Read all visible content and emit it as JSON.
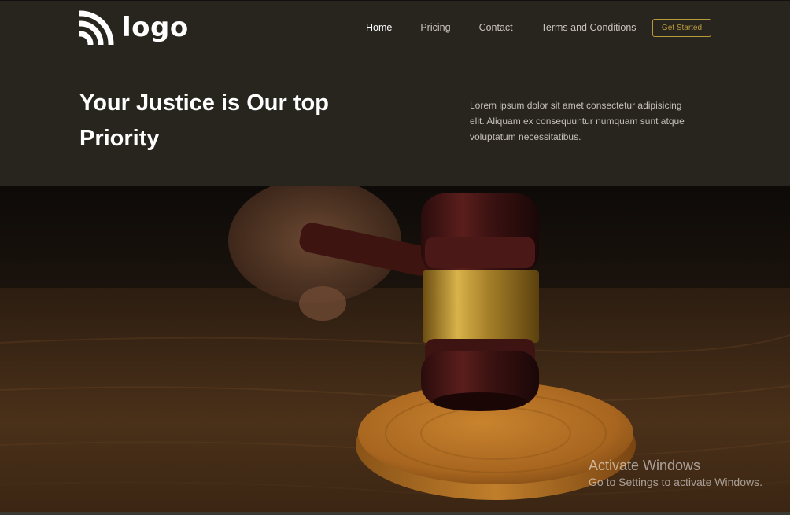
{
  "header": {
    "logo_text": "logo",
    "nav": [
      {
        "label": "Home",
        "active": true
      },
      {
        "label": "Pricing",
        "active": false
      },
      {
        "label": "Contact",
        "active": false
      },
      {
        "label": "Terms and Conditions",
        "active": false
      }
    ],
    "cta_label": "Get Started"
  },
  "hero": {
    "title": "Your Justice is Our top Priority",
    "description": "Lorem ipsum dolor sit amet consectetur adipisicing elit. Aliquam ex consequuntur numquam sunt atque voluptatum necessitatibus.",
    "image_subject": "gavel-photo"
  },
  "system_overlay": {
    "line1": "Activate Windows",
    "line2": "Go to Settings to activate Windows."
  },
  "colors": {
    "background": "#28251f",
    "accent": "#b99a3a",
    "text": "#ffffff",
    "muted_text": "#c4c0b7"
  }
}
